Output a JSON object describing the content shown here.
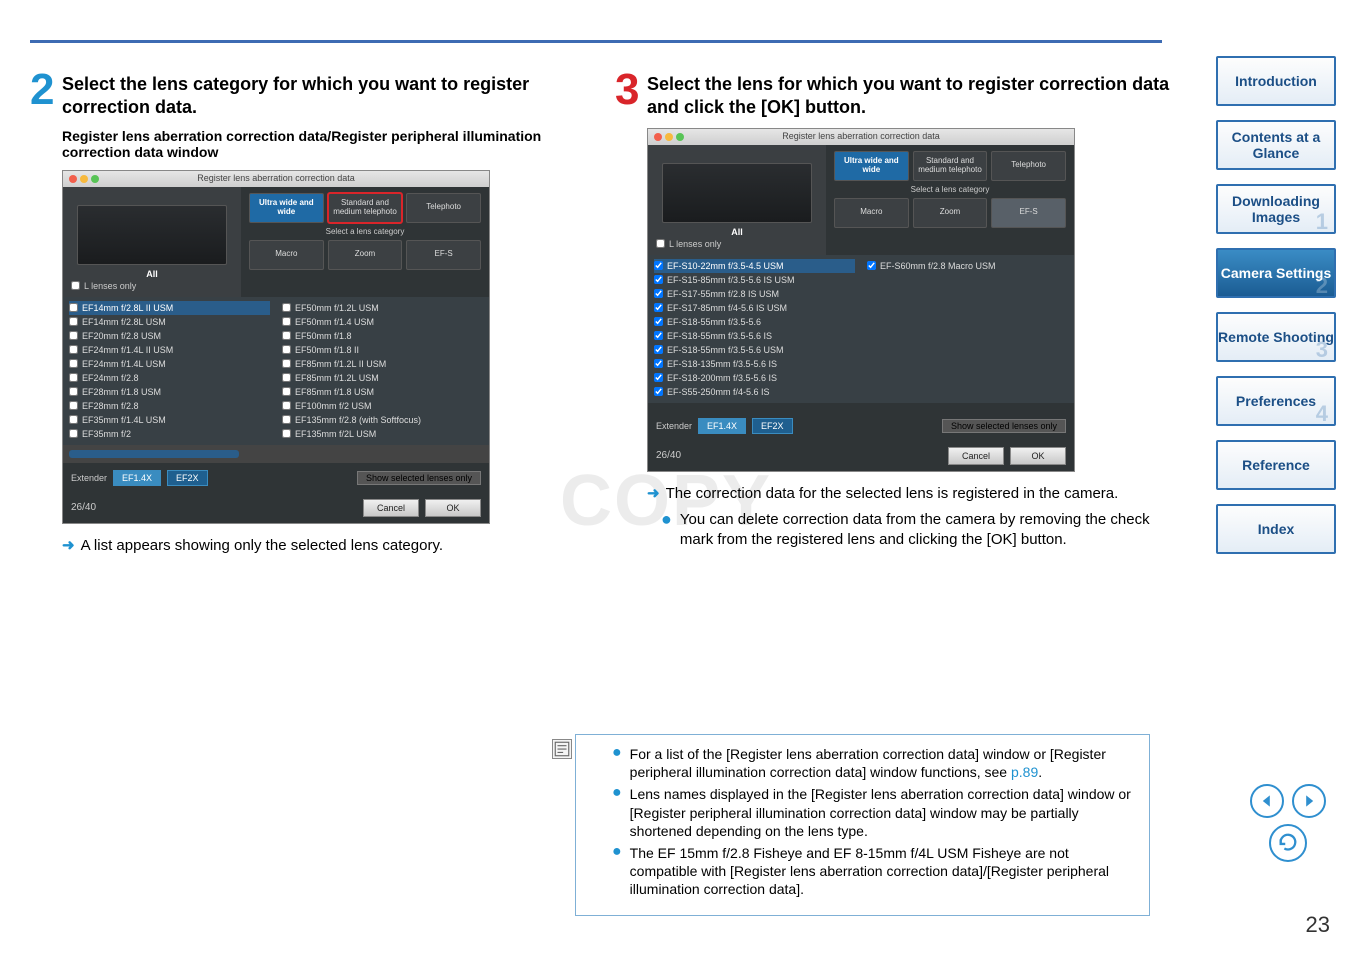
{
  "page_number": "23",
  "watermark": "COPY",
  "top_rule_color": "#3d6bb3",
  "sidebar": [
    {
      "label": "Introduction",
      "num": ""
    },
    {
      "label": "Contents at a Glance",
      "num": ""
    },
    {
      "label": "Downloading Images",
      "num": "1"
    },
    {
      "label": "Camera Settings",
      "num": "2",
      "active": true
    },
    {
      "label": "Remote Shooting",
      "num": "3"
    },
    {
      "label": "Preferences",
      "num": "4"
    },
    {
      "label": "Reference",
      "num": ""
    },
    {
      "label": "Index",
      "num": ""
    }
  ],
  "left": {
    "step_number": "2",
    "title": "Select the lens category for which you want to register correction data.",
    "subtitle": "Register lens aberration correction data/Register peripheral illumination correction data window",
    "caption": "A list appears showing only the selected lens category.",
    "dialog": {
      "title": "Register lens aberration correction data",
      "all_label": "All",
      "l_lenses": "L lenses only",
      "categories": {
        "ultra_wide": "Ultra wide and wide",
        "standard": "Standard and medium telephoto",
        "telephoto": "Telephoto",
        "macro": "Macro",
        "zoom": "Zoom",
        "efs": "EF-S",
        "note": "Select a lens category"
      },
      "lenses_left": [
        "EF14mm f/2.8L II USM",
        "EF14mm f/2.8L USM",
        "EF20mm f/2.8 USM",
        "EF24mm f/1.4L II USM",
        "EF24mm f/1.4L USM",
        "EF24mm f/2.8",
        "EF28mm f/1.8 USM",
        "EF28mm f/2.8",
        "EF35mm f/1.4L USM",
        "EF35mm f/2"
      ],
      "lenses_right": [
        "EF50mm f/1.2L USM",
        "EF50mm f/1.4 USM",
        "EF50mm f/1.8",
        "EF50mm f/1.8 II",
        "EF85mm f/1.2L II USM",
        "EF85mm f/1.2L USM",
        "EF85mm f/1.8 USM",
        "EF100mm f/2 USM",
        "EF135mm f/2.8 (with Softfocus)",
        "EF135mm f/2L USM"
      ],
      "extender": "Extender",
      "ext14": "EF1.4X",
      "ext2": "EF2X",
      "show_selected": "Show selected lenses only",
      "count": "26/40",
      "cancel": "Cancel",
      "ok": "OK"
    }
  },
  "right": {
    "step_number": "3",
    "title": "Select the lens for which you want to register correction data and click the [OK] button.",
    "caption": "The correction data for the selected lens is registered in the camera.",
    "bullet": "You can delete correction data from the camera by removing the check mark from the registered lens and clicking the [OK] button.",
    "dialog": {
      "title": "Register lens aberration correction data",
      "all_label": "All",
      "l_lenses": "L lenses only",
      "categories": {
        "ultra_wide": "Ultra wide and wide",
        "standard": "Standard and medium telephoto",
        "telephoto": "Telephoto",
        "macro": "Macro",
        "zoom": "Zoom",
        "efs": "EF-S",
        "note": "Select a lens category"
      },
      "lenses_left": [
        "EF-S10-22mm f/3.5-4.5 USM",
        "EF-S15-85mm f/3.5-5.6 IS USM",
        "EF-S17-55mm f/2.8 IS USM",
        "EF-S17-85mm f/4-5.6 IS USM",
        "EF-S18-55mm f/3.5-5.6",
        "EF-S18-55mm f/3.5-5.6 IS",
        "EF-S18-55mm f/3.5-5.6 USM",
        "EF-S18-135mm f/3.5-5.6 IS",
        "EF-S18-200mm f/3.5-5.6 IS",
        "EF-S55-250mm f/4-5.6 IS"
      ],
      "lenses_right": [
        "EF-S60mm f/2.8 Macro USM"
      ],
      "extender": "Extender",
      "ext14": "EF1.4X",
      "ext2": "EF2X",
      "show_selected": "Show selected lenses only",
      "count": "26/40",
      "cancel": "Cancel",
      "ok": "OK"
    }
  },
  "notes": {
    "n1a": "For a list of the [Register lens aberration correction data] window or [Register peripheral illumination correction data] window functions, see ",
    "n1_link": "p.89",
    "n1b": ".",
    "n2": "Lens names displayed in the [Register lens aberration correction data] window or [Register peripheral illumination correction data] window may be partially shortened depending on the lens type.",
    "n3": "The EF 15mm f/2.8 Fisheye and EF 8-15mm f/4L USM Fisheye are not compatible with [Register lens aberration correction data]/[Register peripheral illumination correction data]."
  }
}
